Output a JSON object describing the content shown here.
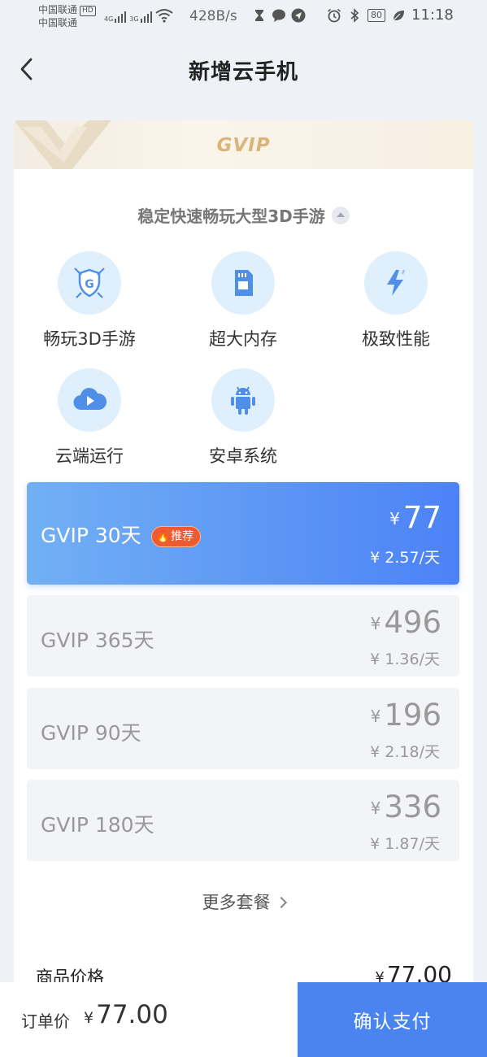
{
  "status_bar": {
    "carrier_1": "中国联通",
    "hd_badge": "HD",
    "carrier_2": "中国联通",
    "network_1": "4G",
    "network_2": "3G",
    "speed": "428B/s",
    "battery": "80",
    "time": "11:18"
  },
  "header": {
    "title": "新增云手机",
    "back_icon": "chevron-left-icon"
  },
  "banner": {
    "logo_text": "GVIP"
  },
  "tagline": "稳定快速畅玩大型3D手游",
  "features": [
    {
      "label": "畅玩3D手游",
      "icon": "game-shield-icon"
    },
    {
      "label": "超大内存",
      "icon": "sd-card-icon"
    },
    {
      "label": "极致性能",
      "icon": "lightning-icon"
    },
    {
      "label": "云端运行",
      "icon": "cloud-play-icon"
    },
    {
      "label": "安卓系统",
      "icon": "android-icon"
    }
  ],
  "plans": [
    {
      "name": "GVIP 30天",
      "currency": "¥",
      "price": "77",
      "daily": "¥ 2.57/天",
      "badge": "推荐",
      "selected": true
    },
    {
      "name": "GVIP 365天",
      "currency": "¥",
      "price": "496",
      "daily": "¥ 1.36/天"
    },
    {
      "name": "GVIP 90天",
      "currency": "¥",
      "price": "196",
      "daily": "¥ 2.18/天"
    },
    {
      "name": "GVIP 180天",
      "currency": "¥",
      "price": "336",
      "daily": "¥ 1.87/天"
    }
  ],
  "more_plans": "更多套餐",
  "goods": {
    "label": "商品价格",
    "currency": "¥",
    "price": "77.00"
  },
  "bottom_bar": {
    "order_label": "订单价",
    "currency": "¥",
    "order_price": "77.00",
    "pay_button": "确认支付"
  },
  "colors": {
    "accent_blue": "#4a84f0",
    "gradient_start": "#72b0f4",
    "gold": "#d9b57a",
    "badge_red": "#ee5a32",
    "feature_circle": "#dff0fc"
  }
}
